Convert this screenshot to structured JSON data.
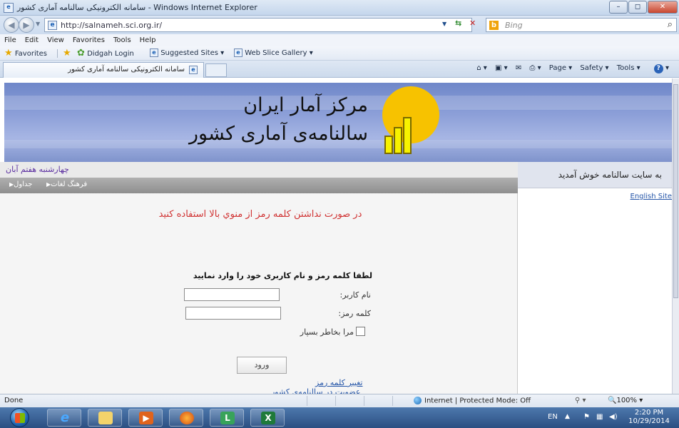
{
  "window": {
    "title": "سامانه الکترونیکی سالنامه آماری کشور - Windows Internet Explorer",
    "controls": {
      "minimize": "–",
      "maximize": "◻",
      "close": "✕"
    }
  },
  "address_bar": {
    "url": "http://salnameh.sci.org.ir/",
    "search_placeholder": "Bing"
  },
  "menu": [
    "File",
    "Edit",
    "View",
    "Favorites",
    "Tools",
    "Help"
  ],
  "favorites_bar": {
    "favorites_label": "Favorites",
    "items": [
      "Didgah Login",
      "Suggested Sites ▾",
      "Web Slice Gallery ▾"
    ]
  },
  "tab": {
    "title": "سامانه الکترونیکی سالنامه آماری کشور"
  },
  "command_bar": {
    "page": "Page ▾",
    "safety": "Safety ▾",
    "tools": "Tools ▾"
  },
  "banner": {
    "title_line1": "مرکز آمار ایران",
    "title_line2": "سالنامه‌ی آماری کشور"
  },
  "left": {
    "date": "چهارشنبه هفتم آبان",
    "nav_links": [
      "فرهنگ لغات",
      "جداول"
    ],
    "warning": "در صورت نداشتن کلمه رمز از منوي بالا استفاده کنید",
    "prompt": "لطفا کلمه رمز و نام کاربری خود را وارد نمایید",
    "username_label": "نام کاربر:",
    "password_label": "کلمه رمز:",
    "remember_label": "مرا بخاطر بسپار",
    "login_button": "ورود",
    "change_password_link": "تغییر کلمه رمز",
    "register_link": "عضویت در سالنامه‌ی کشور"
  },
  "right": {
    "welcome": "به سایت سالنامه خوش آمدید",
    "english_link": "English Site"
  },
  "status_bar": {
    "status": "Done",
    "zone": "Internet | Protected Mode: Off",
    "zoom": "100%  ▾"
  },
  "taskbar": {
    "language": "EN",
    "time": "2:20 PM",
    "date": "10/29/2014"
  }
}
